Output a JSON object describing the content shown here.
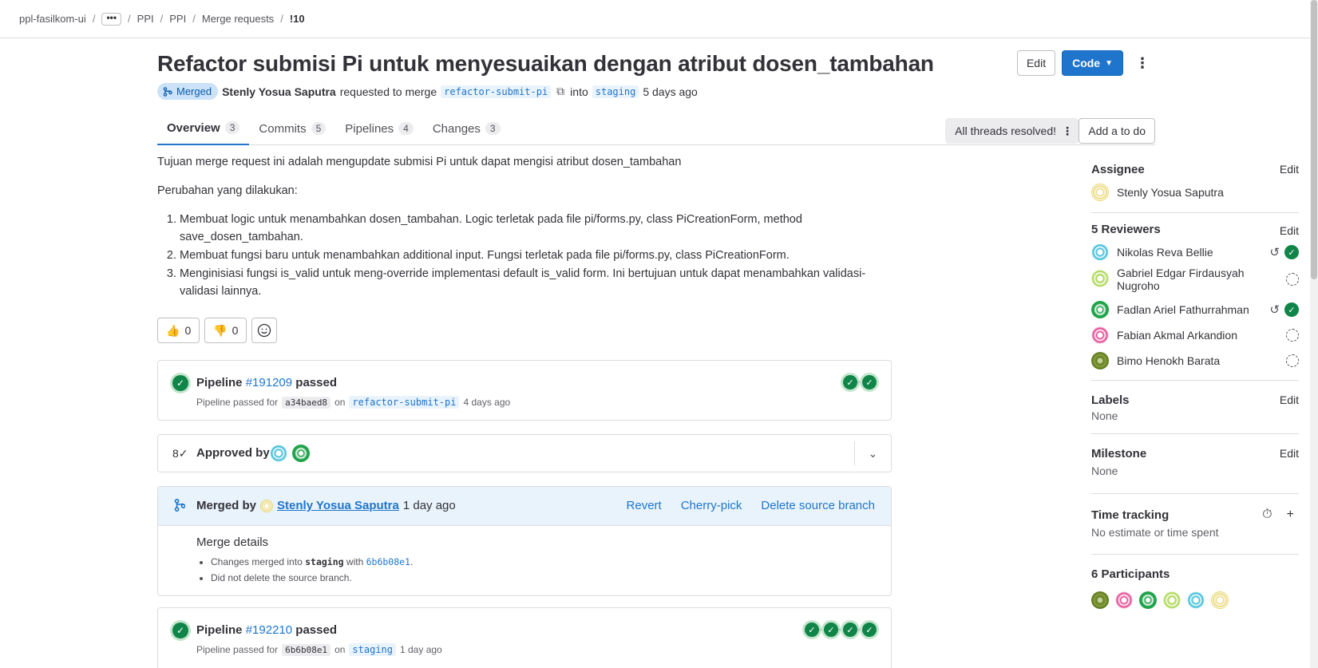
{
  "breadcrumb": {
    "items": [
      "ppl-fasilkom-ui",
      "PPI",
      "PPI",
      "Merge requests"
    ],
    "more": "•••",
    "current": "!10"
  },
  "mr": {
    "title": "Refactor submisi Pi untuk menyesuaikan dengan atribut dosen_tambahan",
    "status": "Merged",
    "author": "Stenly Yosua Saputra",
    "requested_text": "requested to merge",
    "source_branch": "refactor-submit-pi",
    "into_text": "into",
    "target_branch": "staging",
    "age": "5 days ago",
    "edit_label": "Edit",
    "code_label": "Code"
  },
  "tabs": [
    {
      "label": "Overview",
      "count": "3"
    },
    {
      "label": "Commits",
      "count": "5"
    },
    {
      "label": "Pipelines",
      "count": "4"
    },
    {
      "label": "Changes",
      "count": "3"
    }
  ],
  "threads_label": "All threads resolved!",
  "todo_label": "Add a to do",
  "description": {
    "intro": "Tujuan merge request ini adalah mengupdate submisi Pi untuk dapat mengisi atribut dosen_tambahan",
    "changes_heading": "Perubahan yang dilakukan:",
    "items": [
      "Membuat logic untuk menambahkan dosen_tambahan. Logic terletak pada file pi/forms.py, class PiCreationForm, method save_dosen_tambahan.",
      "Membuat fungsi baru untuk menambahkan additional input. Fungsi terletak pada file pi/forms.py, class PiCreationForm.",
      "Menginisiasi fungsi is_valid untuk meng-override implementasi default is_valid form. Ini bertujuan untuk dapat menambahkan validasi-validasi lainnya."
    ]
  },
  "reactions": {
    "thumbsup": "0",
    "thumbsdown": "0",
    "thumbsup_emoji": "👍",
    "thumbsdown_emoji": "👎"
  },
  "pipeline1": {
    "prefix": "Pipeline",
    "id": "#191209",
    "status": "passed",
    "sub_prefix": "Pipeline passed for",
    "sha": "a34baed8",
    "on_text": "on",
    "branch": "refactor-submit-pi",
    "age": "4 days ago"
  },
  "approval": {
    "label": "Approved by"
  },
  "merged": {
    "label": "Merged by",
    "user": "Stenly Yosua Saputra",
    "age": "1 day ago",
    "actions": [
      "Revert",
      "Cherry-pick",
      "Delete source branch"
    ],
    "details_title": "Merge details",
    "line1_prefix": "Changes merged into",
    "line1_branch": "staging",
    "line1_with": "with",
    "line1_sha": "6b6b08e1",
    "line2": "Did not delete the source branch."
  },
  "pipeline2": {
    "prefix": "Pipeline",
    "id": "#192210",
    "status": "passed",
    "sub_prefix": "Pipeline passed for",
    "sha": "6b6b08e1",
    "on_text": "on",
    "branch": "staging",
    "age": "1 day ago"
  },
  "sidebar": {
    "edit_label": "Edit",
    "assignee_title": "Assignee",
    "assignee": "Stenly Yosua Saputra",
    "reviewers_title": "5 Reviewers",
    "reviewers": [
      "Nikolas Reva Bellie",
      "Gabriel Edgar Firdausyah Nugroho",
      "Fadlan Ariel Fathurrahman",
      "Fabian Akmal Arkandion",
      "Bimo Henokh Barata"
    ],
    "labels_title": "Labels",
    "labels_value": "None",
    "milestone_title": "Milestone",
    "milestone_value": "None",
    "time_title": "Time tracking",
    "time_value": "No estimate or time spent",
    "participants_title": "6 Participants"
  }
}
